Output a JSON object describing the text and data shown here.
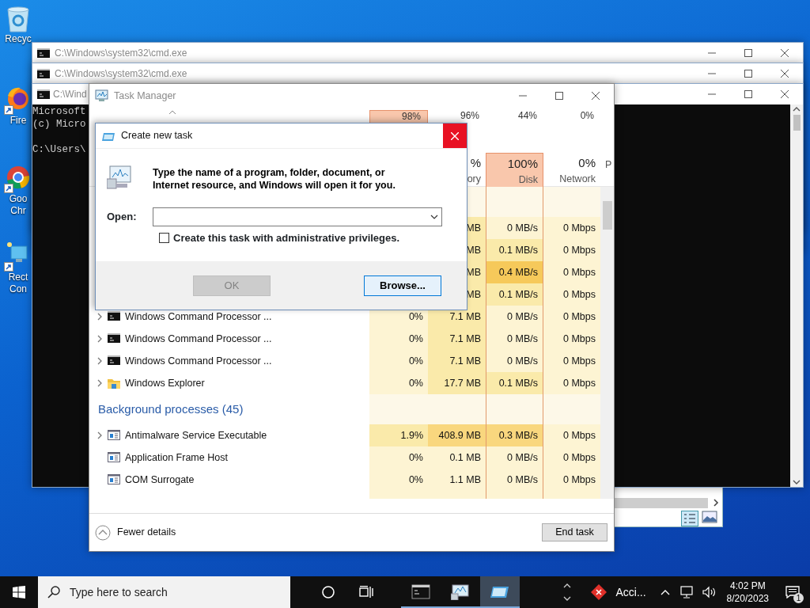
{
  "desktop_icons": [
    {
      "kind": "recycle",
      "label": "Recyc"
    },
    {
      "kind": "fox",
      "label": "Fire"
    },
    {
      "kind": "ring",
      "label": "Goo Chr"
    },
    {
      "kind": "remote",
      "label": "Rect Con"
    }
  ],
  "cmd_windows": [
    {
      "title": "C:\\Windows\\system32\\cmd.exe"
    },
    {
      "title": "C:\\Windows\\system32\\cmd.exe"
    },
    {
      "title": "C:\\Wind",
      "console_blocks": [
        {
          "lines": [
            "Microsoft",
            "(c) Micro"
          ]
        },
        {
          "lines": [
            "C:\\Users\\"
          ]
        }
      ]
    }
  ],
  "task_manager": {
    "title": "Task Manager",
    "summary": [
      {
        "value": "98%",
        "alert": true
      },
      {
        "value": "96%",
        "alert": false
      },
      {
        "value": "44%",
        "alert": false
      },
      {
        "value": "0%",
        "alert": false
      }
    ],
    "columns": [
      {
        "value": "%",
        "label": "ory",
        "alert": false
      },
      {
        "value": "100%",
        "label": "Disk",
        "alert": true
      },
      {
        "value": "0%",
        "label": "Network",
        "alert": false
      },
      {
        "label": "P"
      }
    ],
    "rows": [
      {
        "kind": "hidden",
        "cells": [
          {
            "text": "MB",
            "color": "#faeaaa"
          },
          {
            "text": "0 MB/s",
            "color": "#fdf4d3"
          },
          {
            "text": "0 Mbps",
            "color": "#fdf4d3"
          }
        ]
      },
      {
        "kind": "hidden",
        "cells": [
          {
            "text": "MB",
            "color": "#faeaaa"
          },
          {
            "text": "0.1 MB/s",
            "color": "#faeaaa"
          },
          {
            "text": "0 Mbps",
            "color": "#fdf4d3"
          }
        ]
      },
      {
        "kind": "hidden",
        "cells": [
          {
            "text": "MB",
            "color": "#faeaaa"
          },
          {
            "text": "0.4 MB/s",
            "color": "#f6c95a"
          },
          {
            "text": "0 Mbps",
            "color": "#fdf4d3"
          }
        ]
      },
      {
        "kind": "hidden",
        "cells": [
          {
            "text": "MB",
            "color": "#faeaaa"
          },
          {
            "text": "0.1 MB/s",
            "color": "#faeaaa"
          },
          {
            "text": "0 Mbps",
            "color": "#fdf4d3"
          }
        ]
      },
      {
        "kind": "console",
        "name": "Windows Command Processor ...",
        "expandable": true,
        "cells": [
          {
            "text": "0%",
            "color": "#fdf4d3"
          },
          {
            "text": "7.1 MB",
            "color": "#faeaaa"
          },
          {
            "text": "0 MB/s",
            "color": "#fdf4d3"
          },
          {
            "text": "0 Mbps",
            "color": "#fdf4d3"
          }
        ]
      },
      {
        "kind": "console",
        "name": "Windows Command Processor ...",
        "expandable": true,
        "cells": [
          {
            "text": "0%",
            "color": "#fdf4d3"
          },
          {
            "text": "7.1 MB",
            "color": "#faeaaa"
          },
          {
            "text": "0 MB/s",
            "color": "#fdf4d3"
          },
          {
            "text": "0 Mbps",
            "color": "#fdf4d3"
          }
        ]
      },
      {
        "kind": "console",
        "name": "Windows Command Processor ...",
        "expandable": true,
        "cells": [
          {
            "text": "0%",
            "color": "#fdf4d3"
          },
          {
            "text": "7.1 MB",
            "color": "#faeaaa"
          },
          {
            "text": "0 MB/s",
            "color": "#fdf4d3"
          },
          {
            "text": "0 Mbps",
            "color": "#fdf4d3"
          }
        ]
      },
      {
        "kind": "folder",
        "name": "Windows Explorer",
        "expandable": true,
        "cells": [
          {
            "text": "0%",
            "color": "#fdf4d3"
          },
          {
            "text": "17.7 MB",
            "color": "#faeaaa"
          },
          {
            "text": "0.1 MB/s",
            "color": "#faeaaa"
          },
          {
            "text": "0 Mbps",
            "color": "#fdf4d3"
          }
        ]
      },
      {
        "kind": "group",
        "name": "Background processes (45)"
      },
      {
        "kind": "app",
        "name": "Antimalware Service Executable",
        "expandable": true,
        "cells": [
          {
            "text": "1.9%",
            "color": "#faeaaa"
          },
          {
            "text": "408.9 MB",
            "color": "#f9d77e"
          },
          {
            "text": "0.3 MB/s",
            "color": "#f9d77e"
          },
          {
            "text": "0 Mbps",
            "color": "#fdf4d3"
          }
        ]
      },
      {
        "kind": "app",
        "name": "Application Frame Host",
        "expandable": false,
        "cells": [
          {
            "text": "0%",
            "color": "#fdf4d3"
          },
          {
            "text": "0.1 MB",
            "color": "#fdf4d3"
          },
          {
            "text": "0 MB/s",
            "color": "#fdf4d3"
          },
          {
            "text": "0 Mbps",
            "color": "#fdf4d3"
          }
        ]
      },
      {
        "kind": "app",
        "name": "COM Surrogate",
        "expandable": false,
        "cells": [
          {
            "text": "0%",
            "color": "#fdf4d3"
          },
          {
            "text": "1.1 MB",
            "color": "#fdf4d3"
          },
          {
            "text": "0 MB/s",
            "color": "#fdf4d3"
          },
          {
            "text": "0 Mbps",
            "color": "#fdf4d3"
          }
        ]
      }
    ],
    "footer": {
      "details_toggle": "Fewer details",
      "end_task": "End task"
    }
  },
  "dialog": {
    "title": "Create new task",
    "message": "Type the name of a program, folder, document, or Internet resource, and Windows will open it for you.",
    "open_label": "Open:",
    "admin_checkbox": {
      "label": "Create this task with administrative privileges.",
      "checked": false
    },
    "buttons": [
      {
        "label": "OK",
        "disabled": true,
        "focused": false
      },
      {
        "label": "Browse...",
        "disabled": false,
        "focused": true
      }
    ]
  },
  "taskbar": {
    "search_placeholder": "Type here to search",
    "apps": [
      {
        "kind": "console",
        "active": false
      },
      {
        "kind": "monitor",
        "active": false
      },
      {
        "kind": "run",
        "active": true
      }
    ],
    "tray_app": "Acci...",
    "time": "4:02 PM",
    "date": "8/20/2023",
    "notifications": "1"
  }
}
